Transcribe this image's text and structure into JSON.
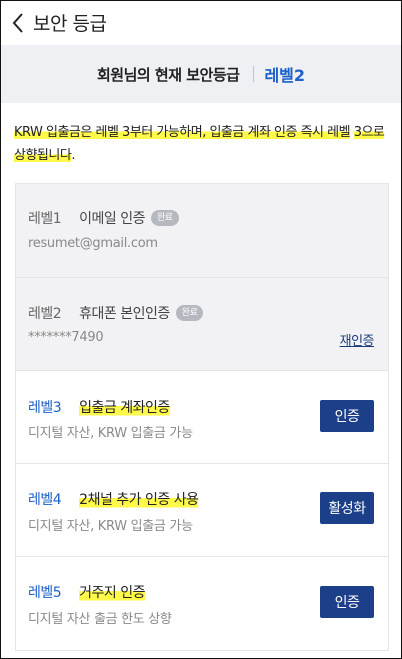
{
  "header": {
    "title": "보안 등급"
  },
  "banner": {
    "text": "회원님의 현재 보안등급",
    "current_level": "레벨2"
  },
  "notice": {
    "part1": "KRW 입출금은 레벨 3부터 가능하며, 입출금 계좌 인증 즉시 레벨",
    "part2": "3으로 상향됩니다",
    "part3": "."
  },
  "levels": [
    {
      "level": "레벨1",
      "name": "이메일 인증",
      "badge": "완료",
      "sub": "resumet@gmail.com"
    },
    {
      "level": "레벨2",
      "name": "휴대폰 본인인증",
      "badge": "완료",
      "sub": "*******7490",
      "link": "재인증"
    },
    {
      "level": "레벨3",
      "name": "입출금 계좌인증",
      "sub": "디지털 자산, KRW 입출금 가능",
      "button": "인증"
    },
    {
      "level": "레벨4",
      "name": "2채널 추가 인증 사용",
      "sub": "디지털 자산, KRW 입출금 가능",
      "button": "활성화"
    },
    {
      "level": "레벨5",
      "name": "거주지 인증",
      "sub": "디지털 자산 출금 한도 상향",
      "button": "인증"
    }
  ],
  "colors": {
    "accent_blue": "#1b5fc9",
    "button_navy": "#1b3f88",
    "highlight_yellow": "#fff94a",
    "banner_bg": "#eef0f4"
  }
}
